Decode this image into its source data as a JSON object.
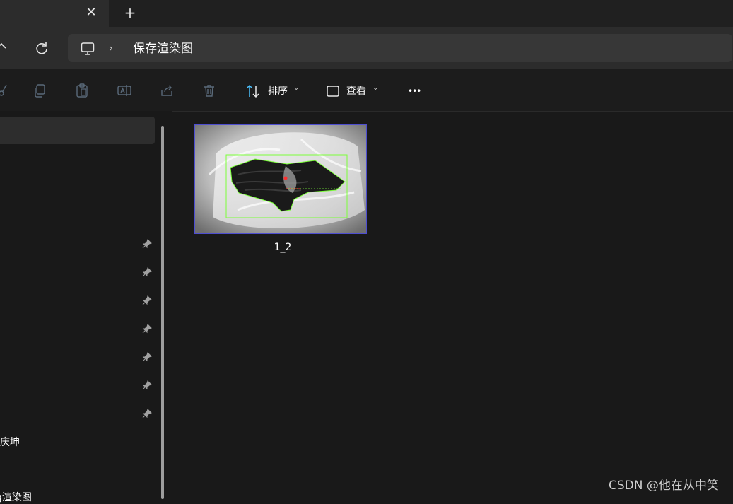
{
  "tabs": {
    "close_glyph": "✕",
    "new_tab_glyph": "+"
  },
  "address": {
    "separator": "›",
    "current_folder": "保存渲染图",
    "icons": [
      "up-arrow-icon",
      "refresh-icon",
      "this-pc-icon"
    ]
  },
  "commandbar": {
    "icons": [
      "cut-icon",
      "copy-icon",
      "paste-icon",
      "rename-icon",
      "share-icon",
      "delete-icon"
    ],
    "sort_label": "排序",
    "view_label": "查看",
    "more_glyph": "•••",
    "chevron": "⌄"
  },
  "nav": {
    "pinned_count": 7,
    "items": [
      {
        "label": "庆坤"
      },
      {
        "label": "g渲染图"
      }
    ]
  },
  "files": [
    {
      "name": "1_2"
    }
  ],
  "watermark": "CSDN @他在从中笑",
  "colors": {
    "accent": "#4cc2ff",
    "selection_border": "#4e4ed0",
    "detect_box": "#7cff3a"
  }
}
